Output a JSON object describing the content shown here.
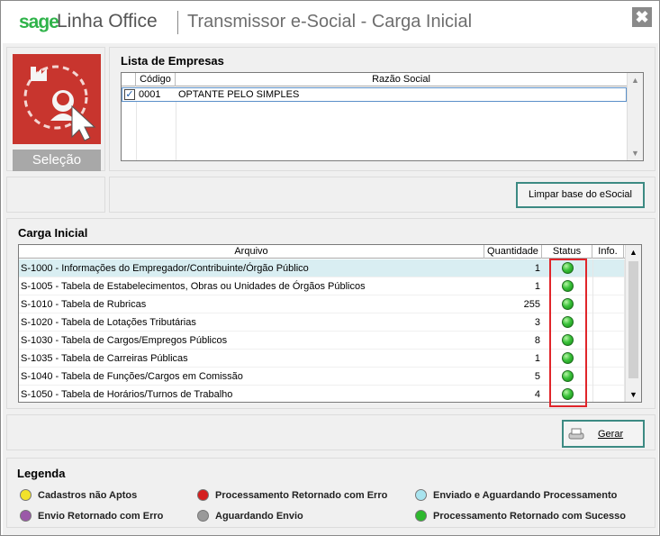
{
  "window": {
    "brand_sage": "sage",
    "brand_linha": "Linha Office",
    "title": "Transmissor e-Social - Carga Inicial",
    "close_glyph": "✖"
  },
  "selecao": {
    "label": "Seleção",
    "icon": "company-selection-icon"
  },
  "empresas": {
    "title": "Lista de Empresas",
    "columns": [
      "Código",
      "Razão Social"
    ],
    "rows": [
      {
        "checked": true,
        "codigo": "0001",
        "razao_social": "OPTANTE PELO SIMPLES"
      }
    ]
  },
  "limpar_button": "Limpar base do eSocial",
  "carga": {
    "title": "Carga Inicial",
    "columns": [
      "Arquivo",
      "Quantidade",
      "Status",
      "Info."
    ],
    "rows": [
      {
        "arquivo": "S-1000 - Informações do Empregador/Contribuinte/Órgão Público",
        "quantidade": "1",
        "status": "green"
      },
      {
        "arquivo": "S-1005 - Tabela de Estabelecimentos, Obras ou Unidades de Órgãos Públicos",
        "quantidade": "1",
        "status": "green"
      },
      {
        "arquivo": "S-1010 - Tabela de Rubricas",
        "quantidade": "255",
        "status": "green"
      },
      {
        "arquivo": "S-1020 - Tabela de Lotações Tributárias",
        "quantidade": "3",
        "status": "green"
      },
      {
        "arquivo": "S-1030 - Tabela de Cargos/Empregos Públicos",
        "quantidade": "8",
        "status": "green"
      },
      {
        "arquivo": "S-1035 - Tabela de Carreiras Públicas",
        "quantidade": "1",
        "status": "green"
      },
      {
        "arquivo": "S-1040 - Tabela de Funções/Cargos em Comissão",
        "quantidade": "5",
        "status": "green"
      },
      {
        "arquivo": "S-1050 - Tabela de Horários/Turnos de Trabalho",
        "quantidade": "4",
        "status": "green"
      }
    ]
  },
  "gerar_button": "Gerar",
  "legenda": {
    "title": "Legenda",
    "items": [
      {
        "label": "Cadastros não Aptos",
        "color": "#f2e22a"
      },
      {
        "label": "Processamento Retornado com Erro",
        "color": "#d41f1f"
      },
      {
        "label": "Enviado e Aguardando Processamento",
        "color": "#a8e4ef"
      },
      {
        "label": "Envio Retornado com Erro",
        "color": "#9b59a8"
      },
      {
        "label": "Aguardando Envio",
        "color": "#9a9a9a"
      },
      {
        "label": "Processamento Retornado com Sucesso",
        "color": "#2eb82e"
      }
    ]
  },
  "colors": {
    "accent": "#3c8a83",
    "brand_green": "#2fb34a",
    "highlight_row": "#d9eef2",
    "red_box": "#e0252a"
  }
}
